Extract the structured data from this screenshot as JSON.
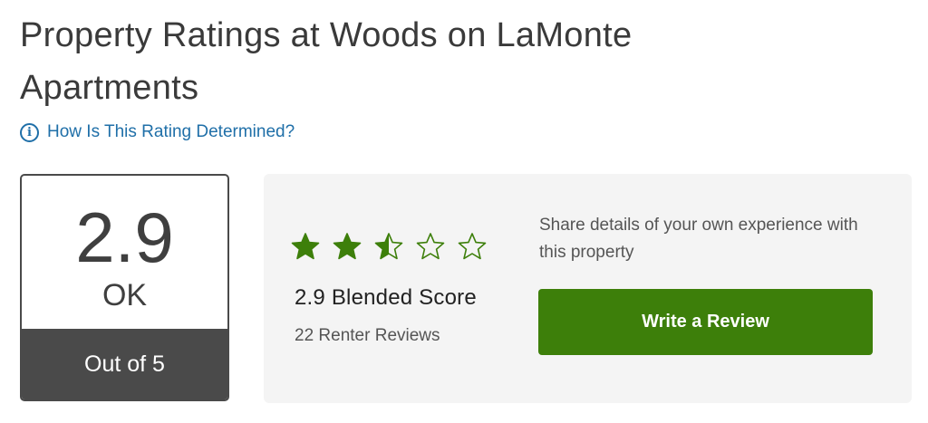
{
  "header": {
    "title": "Property Ratings at Woods on LaMonte Apartments",
    "info_icon": "info-circle-icon",
    "info_link": "How Is This Rating Determined?"
  },
  "score_box": {
    "score": "2.9",
    "rating_word": "OK",
    "out_of": "Out of 5"
  },
  "rating": {
    "stars_value": 2.9,
    "stars_max": 5,
    "star_color": "#3d7f0a",
    "blended_label": "2.9 Blended Score",
    "review_count": "22 Renter Reviews"
  },
  "cta": {
    "share_text": "Share details of your own experience with this property",
    "button_label": "Write a Review",
    "button_color": "#3d7f0a"
  }
}
